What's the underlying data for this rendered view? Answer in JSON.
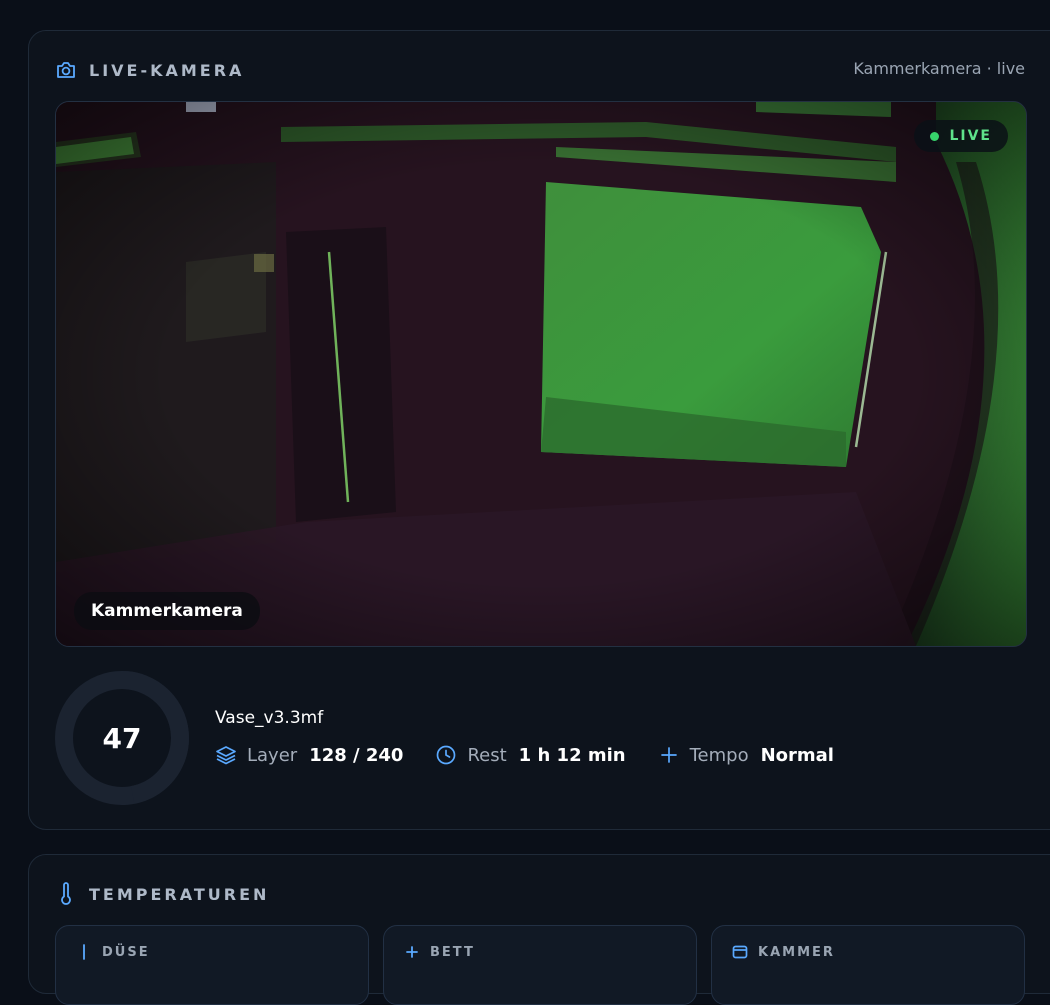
{
  "camera_card": {
    "title": "LIVE-KAMERA",
    "subtitle": "Kammerkamera · live",
    "live_badge": "LIVE",
    "camera_label": "Kammerkamera",
    "icon": "camera-icon"
  },
  "print_job": {
    "progress_value": "47",
    "progress_fraction": 0.47,
    "file_name": "Vase_v3.3mf",
    "layer": {
      "label": "Layer",
      "value": "128 / 240",
      "icon": "layers-icon"
    },
    "remaining": {
      "label": "Rest",
      "value": "1 h 12 min",
      "icon": "clock-icon"
    },
    "speed": {
      "label": "Tempo",
      "value": "Normal",
      "icon": "plus-icon"
    }
  },
  "temperatures_card": {
    "title": "TEMPERATUREN",
    "icon": "thermometer-icon",
    "tiles": [
      {
        "title": "DÜSE",
        "icon": "nozzle-icon"
      },
      {
        "title": "BETT",
        "icon": "bed-icon"
      },
      {
        "title": "KAMMER",
        "icon": "chamber-icon"
      }
    ]
  },
  "colors": {
    "accent": "#5aa9ff",
    "live_green": "#37d36b",
    "background": "#0a0f18",
    "card": "#0d131c"
  }
}
